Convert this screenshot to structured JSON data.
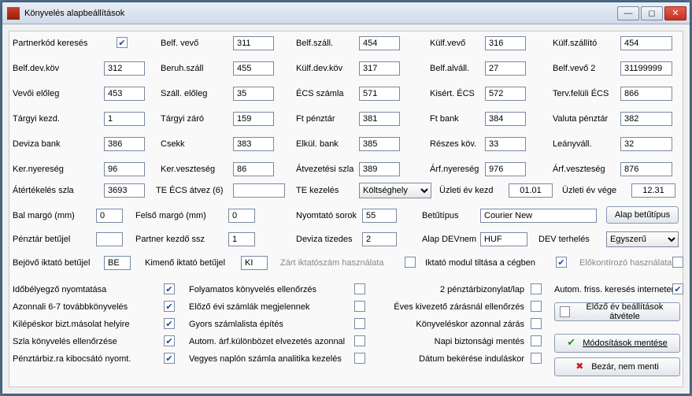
{
  "window": {
    "title": "Könyvelés alapbeállítások"
  },
  "rows": [
    [
      {
        "label": "Partnerkód keresés",
        "check": true
      },
      {
        "label": "Belf. vevő",
        "value": "311"
      },
      {
        "label": "Belf.száll.",
        "value": "454"
      },
      {
        "label": "Külf.vevő",
        "value": "316"
      },
      {
        "label": "Külf.szállító",
        "value": "454"
      }
    ],
    [
      {
        "label": "Belf.dev.köv",
        "value": "312"
      },
      {
        "label": "Beruh.száll",
        "value": "455"
      },
      {
        "label": "Külf.dev.köv",
        "value": "317"
      },
      {
        "label": "Belf.alváll.",
        "value": "27"
      },
      {
        "label": "Belf.vevő 2",
        "value": "31199999"
      }
    ],
    [
      {
        "label": "Vevői előleg",
        "value": "453"
      },
      {
        "label": "Száll. előleg",
        "value": "35"
      },
      {
        "label": "ÉCS számla",
        "value": "571"
      },
      {
        "label": "Kisért. ÉCS",
        "value": "572"
      },
      {
        "label": "Terv.felüli ÉCS",
        "value": "866"
      }
    ],
    [
      {
        "label": "Tárgyi kezd.",
        "value": "1"
      },
      {
        "label": "Tárgyi záró",
        "value": "159"
      },
      {
        "label": "Ft pénztár",
        "value": "381"
      },
      {
        "label": "Ft bank",
        "value": "384"
      },
      {
        "label": "Valuta pénztár",
        "value": "382"
      }
    ],
    [
      {
        "label": "Deviza bank",
        "value": "386"
      },
      {
        "label": "Csekk",
        "value": "383"
      },
      {
        "label": "Elkül. bank",
        "value": "385"
      },
      {
        "label": "Részes köv.",
        "value": "33"
      },
      {
        "label": "Leányváll.",
        "value": "32"
      }
    ],
    [
      {
        "label": "Ker.nyereség",
        "value": "96"
      },
      {
        "label": "Ker.veszteség",
        "value": "86"
      },
      {
        "label": "Átvezetési szla",
        "value": "389"
      },
      {
        "label": "Árf.nyereség",
        "value": "976"
      },
      {
        "label": "Árf.veszteség",
        "value": "876"
      }
    ]
  ],
  "row7": {
    "atertekel_label": "Átértékelés szla",
    "atertekel_value": "3693",
    "teecs_label": "TE ÉCS átvez (6)",
    "teecs_value": "",
    "tekezeles_label": "TE kezelés",
    "tekezeles_value": "Költséghely",
    "uzletkezd_label": "Üzleti év kezd",
    "uzletkezd_value": "01.01",
    "uzletvege_label": "Üzleti év vége",
    "uzletvege_value": "12.31"
  },
  "row8": {
    "balmargo_label": "Bal margó (mm)",
    "balmargo_value": "0",
    "felsomargo_label": "Felső margó (mm)",
    "felsomargo_value": "0",
    "nyomtatosorok_label": "Nyomtató sorok",
    "nyomtatosorok_value": "55",
    "betutipus_label": "Betűtípus",
    "betutipus_value": "Courier New",
    "alapbetu_btn": "Alap betűtípus"
  },
  "row9": {
    "penztarbetu_label": "Pénztár betűjel",
    "penztarbetu_value": "",
    "partnerkezdo_label": "Partner kezdő ssz",
    "partnerkezdo_value": "1",
    "devizatizedes_label": "Deviza tizedes",
    "devizatizedes_value": "2",
    "alapdevnem_label": "Alap DEVnem",
    "alapdevnem_value": "HUF",
    "devterheles_label": "DEV terhelés",
    "devterheles_value": "Egyszerű"
  },
  "row10": {
    "bejovo_label": "Bejövő iktató betűjel",
    "bejovo_value": "BE",
    "kimeno_label": "Kimenő iktató betűjel",
    "kimeno_value": "KI",
    "zart_label": "Zárt iktatószám használata",
    "zart_check": false,
    "iktato_label": "Iktató modul tiltása a cégben",
    "iktato_check": true,
    "elokontir_label": "Előkontírozó használata",
    "elokontir_check": false
  },
  "leftchecks": [
    {
      "label": "Időbélyegző nyomtatása",
      "check": true
    },
    {
      "label": "Azonnali 6-7 továbbkönyvelés",
      "check": true
    },
    {
      "label": "Kilépéskor bizt.másolat helyire",
      "check": true
    },
    {
      "label": "Szla könyvelés ellenőrzése",
      "check": true
    },
    {
      "label": "Pénztárbiz.ra kibocsátó nyomt.",
      "check": true
    }
  ],
  "midchecks": [
    {
      "label": "Folyamatos könyvelés ellenőrzés",
      "check": false
    },
    {
      "label": "Előző évi számlák megjelennek",
      "check": false
    },
    {
      "label": "Gyors számlalista építés",
      "check": false
    },
    {
      "label": "Autom. árf.különbözet elvezetés azonnal",
      "check": false
    },
    {
      "label": "Vegyes naplón számla analitika kezelés",
      "check": false
    }
  ],
  "rightchecks": [
    {
      "label": "2 pénztárbizonylat/lap",
      "check": false
    },
    {
      "label": "Éves kivezető zárásnál ellenőrzés",
      "check": false
    },
    {
      "label": "Könyveléskor azonnal zárás",
      "check": false
    },
    {
      "label": "Napi biztonsági mentés",
      "check": false
    },
    {
      "label": "Dátum bekérése induláskor",
      "check": false
    }
  ],
  "farright": {
    "autom_label": "Autom. friss. keresés interneten",
    "autom_check": true,
    "btn_prev": "Előző év beállítások átvétele",
    "btn_save": "Módosítások mentése",
    "btn_cancel": "Bezár, nem menti"
  }
}
